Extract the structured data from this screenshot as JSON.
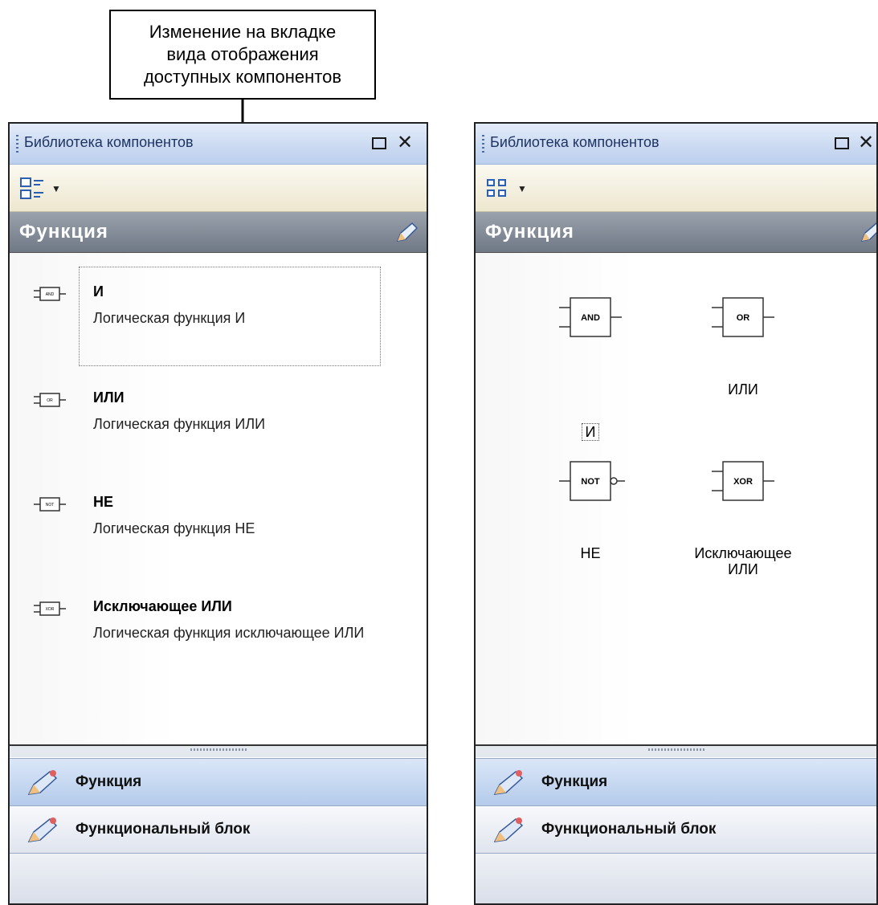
{
  "callout": {
    "line1": "Изменение на вкладке",
    "line2": "вида отображения",
    "line3": "доступных компонентов"
  },
  "left_panel": {
    "title": "Библиотека компонентов",
    "view_button_icon": "list-view-icon",
    "group_title": "Функция",
    "items": [
      {
        "name": "И",
        "desc": "Логическая функция И",
        "icon": "and-gate-icon",
        "badge": "AND"
      },
      {
        "name": "ИЛИ",
        "desc": "Логическая функция ИЛИ",
        "icon": "or-gate-icon",
        "badge": "OR"
      },
      {
        "name": "НЕ",
        "desc": "Логическая функция НЕ",
        "icon": "not-gate-icon",
        "badge": "NOT"
      },
      {
        "name": "Исключающее ИЛИ",
        "desc": "Логическая функция исключающее ИЛИ",
        "icon": "xor-gate-icon",
        "badge": "XOR"
      }
    ],
    "nav": [
      {
        "label": "Функция",
        "active": true
      },
      {
        "label": "Функциональный блок",
        "active": false
      }
    ]
  },
  "right_panel": {
    "title": "Библиотека компонентов",
    "view_button_icon": "icon-view-icon",
    "group_title": "Функция",
    "items": [
      {
        "label": "И",
        "badge": "AND"
      },
      {
        "label": "ИЛИ",
        "badge": "OR"
      },
      {
        "label": "НЕ",
        "badge": "NOT"
      },
      {
        "label_line1": "Исключающее",
        "label_line2": "ИЛИ",
        "badge": "XOR"
      }
    ],
    "nav": [
      {
        "label": "Функция",
        "active": true
      },
      {
        "label": "Функциональный блок",
        "active": false
      }
    ]
  }
}
